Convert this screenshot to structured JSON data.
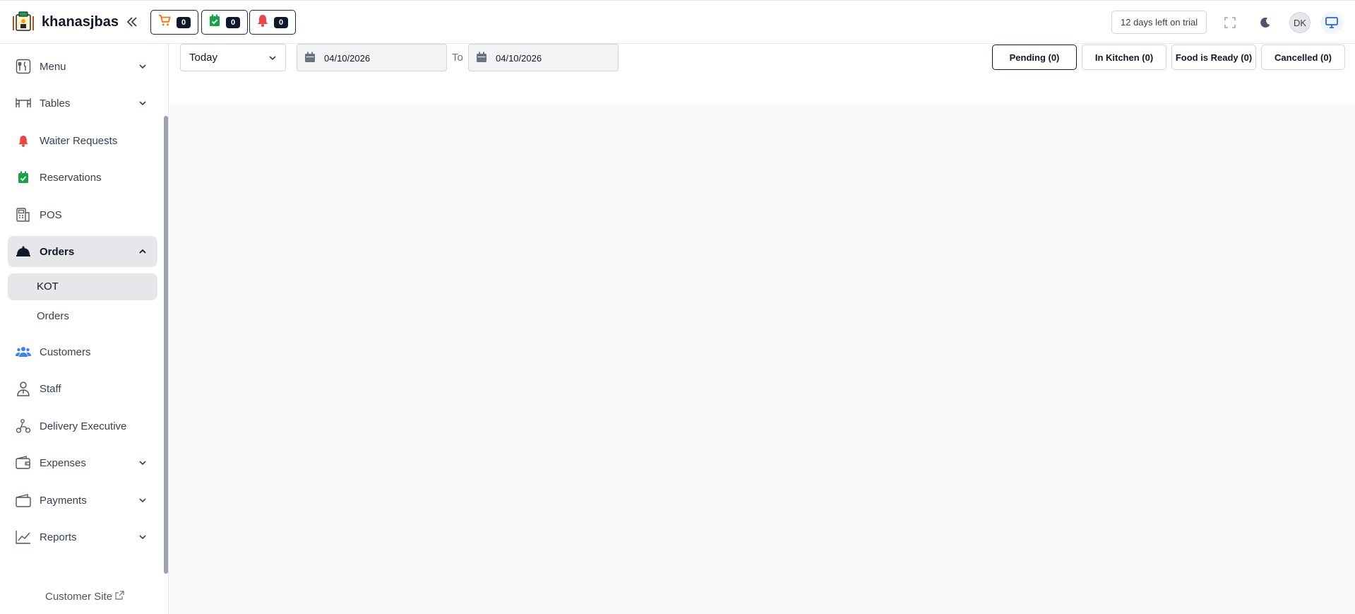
{
  "app": {
    "name": "khanasjbas"
  },
  "header": {
    "counters": [
      {
        "icon": "cart-icon",
        "value": "0",
        "color": "#f97316"
      },
      {
        "icon": "calendar-check-icon",
        "value": "0",
        "color": "#16a34a"
      },
      {
        "icon": "bell-icon",
        "value": "0",
        "color": "#ef4444"
      }
    ],
    "trial_text": "12 days left on trial",
    "avatar_initials": "DK"
  },
  "sidebar": {
    "items": [
      {
        "label": "Menu",
        "icon": "utensils-icon",
        "expandable": true
      },
      {
        "label": "Tables",
        "icon": "table-icon",
        "expandable": true
      },
      {
        "label": "Waiter Requests",
        "icon": "bell-icon",
        "expandable": false
      },
      {
        "label": "Reservations",
        "icon": "calendar-check-icon",
        "expandable": false
      },
      {
        "label": "POS",
        "icon": "pos-icon",
        "expandable": false
      },
      {
        "label": "Orders",
        "icon": "cloche-icon",
        "expandable": true,
        "expanded": true
      },
      {
        "label": "Customers",
        "icon": "users-icon",
        "expandable": false
      },
      {
        "label": "Staff",
        "icon": "staff-icon",
        "expandable": false
      },
      {
        "label": "Delivery Executive",
        "icon": "scooter-icon",
        "expandable": false
      },
      {
        "label": "Expenses",
        "icon": "wallet-icon",
        "expandable": true
      },
      {
        "label": "Payments",
        "icon": "payments-icon",
        "expandable": true
      },
      {
        "label": "Reports",
        "icon": "chart-line-icon",
        "expandable": true
      }
    ],
    "orders_sub": [
      {
        "label": "KOT",
        "active": true
      },
      {
        "label": "Orders",
        "active": false
      }
    ],
    "footer_link": "Customer Site"
  },
  "filters": {
    "range": "Today",
    "date_from": "04/10/2026",
    "to_label": "To",
    "date_to": "04/10/2026",
    "status_tabs": [
      {
        "label": "Pending (0)",
        "active": true
      },
      {
        "label": "In Kitchen (0)",
        "active": false
      },
      {
        "label": "Food is Ready (0)",
        "active": false
      },
      {
        "label": "Cancelled (0)",
        "active": false
      }
    ]
  },
  "colors": {
    "accent_blue": "#2563eb",
    "waiter_red": "#ef4444",
    "reservation_green": "#16a34a",
    "customers_blue": "#3b82f6",
    "active_bg": "#e5e7eb"
  }
}
